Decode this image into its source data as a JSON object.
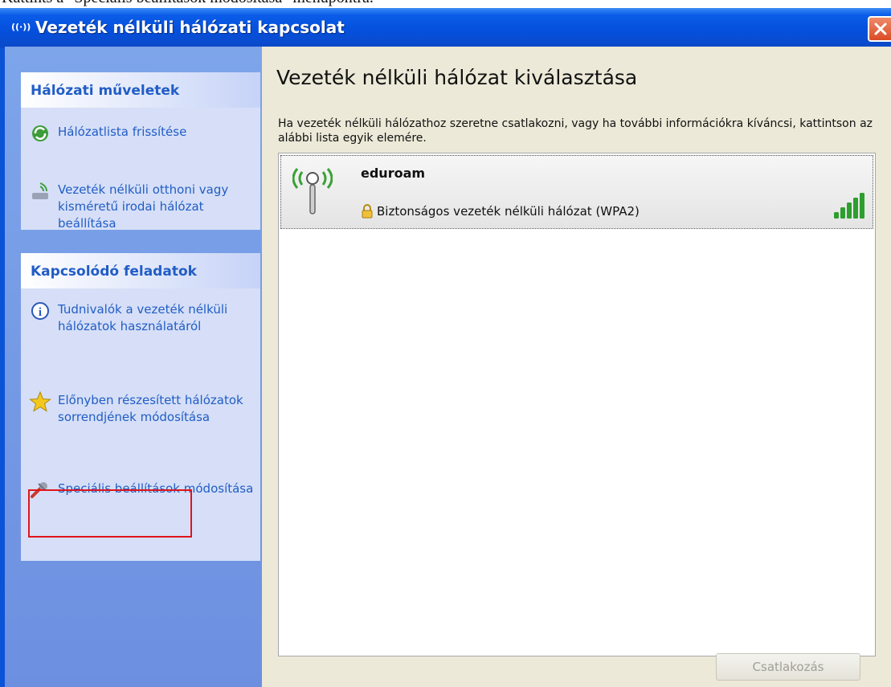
{
  "page": {
    "caption": "Kattints a \"Speciális beállítások módosítása\" menüpontra."
  },
  "window": {
    "title": "Vezeték nélküli hálózati kapcsolat",
    "close_icon": "close-icon"
  },
  "sidebar": {
    "sections": [
      {
        "title": "Hálózati műveletek",
        "items": [
          {
            "label": "Hálózatlista frissítése",
            "icon": "refresh-icon"
          },
          {
            "label": "Vezeték nélküli otthoni vagy kisméretű irodai hálózat beállítása",
            "icon": "wireless-setup-icon"
          }
        ]
      },
      {
        "title": "Kapcsolódó feladatok",
        "items": [
          {
            "label": "Tudnivalók a vezeték nélküli hálózatok használatáról",
            "icon": "info-icon"
          },
          {
            "label": "Előnyben részesített hálózatok sorrendjének módosítása",
            "icon": "star-icon"
          },
          {
            "label": "Speciális beállítások módosítása",
            "icon": "advanced-settings-icon",
            "highlighted": true
          }
        ]
      }
    ]
  },
  "main": {
    "title": "Vezeték nélküli hálózat kiválasztása",
    "description": "Ha vezeték nélküli hálózathoz szeretne csatlakozni, vagy ha további információkra kíváncsi, kattintson az alábbi lista egyik elemére.",
    "networks": [
      {
        "ssid": "eduroam",
        "security": "Biztonságos vezeték nélküli hálózat (WPA2)",
        "signal_bars": 5,
        "signal_max": 5,
        "selected": true
      }
    ],
    "connect_button": "Csatlakozás",
    "connect_enabled": false
  },
  "colors": {
    "titlebar": "#0550dd",
    "sidebar": "#7da5ea",
    "panel": "#d6dff7",
    "link": "#215dc6",
    "highlight": "#e0141b",
    "signal": "#2e9e2e"
  }
}
